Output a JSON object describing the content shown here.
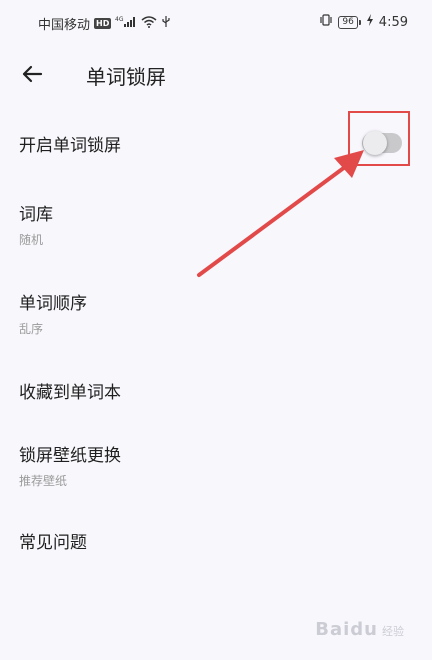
{
  "status_bar": {
    "carrier": "中国移动",
    "hd_badge": "HD",
    "network": "4G",
    "battery_level": "96",
    "time": "4:59"
  },
  "toolbar": {
    "title": "单词锁屏"
  },
  "settings": {
    "items": [
      {
        "title": "开启单词锁屏",
        "subtitle": null,
        "toggle_on": false
      },
      {
        "title": "词库",
        "subtitle": "随机"
      },
      {
        "title": "单词顺序",
        "subtitle": "乱序"
      },
      {
        "title": "收藏到单词本",
        "subtitle": null
      },
      {
        "title": "锁屏壁纸更换",
        "subtitle": "推荐壁纸"
      },
      {
        "title": "常见问题",
        "subtitle": null
      }
    ]
  },
  "colors": {
    "background": "#f8f7fc",
    "annotation_red": "#e24a4a",
    "switch_track_off": "#c9c9cc"
  },
  "watermark": {
    "brand": "Baidu",
    "suffix": "经验"
  }
}
